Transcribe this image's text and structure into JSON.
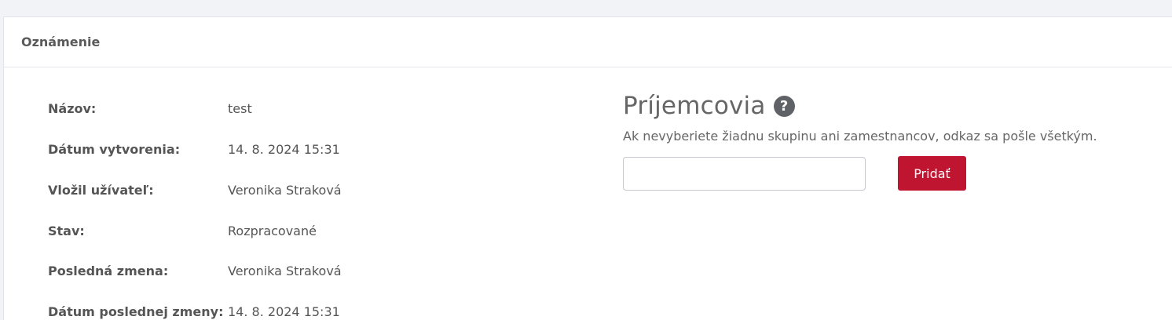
{
  "card": {
    "title": "Oznámenie"
  },
  "details": [
    {
      "label": "Názov:",
      "value": "test"
    },
    {
      "label": "Dátum vytvorenia:",
      "value": "14. 8. 2024 15:31"
    },
    {
      "label": "Vložil užívateľ:",
      "value": "Veronika Straková"
    },
    {
      "label": "Stav:",
      "value": "Rozpracované"
    },
    {
      "label": "Posledná zmena:",
      "value": "Veronika Straková"
    },
    {
      "label": "Dátum poslednej zmeny:",
      "value": "14. 8. 2024 15:31"
    }
  ],
  "recipients": {
    "title": "Príjemcovia",
    "help_icon_glyph": "?",
    "hint": "Ak nevyberiete žiadnu skupinu ani zamestnancov, odkaz sa pošle všetkým.",
    "input_value": "",
    "add_label": "Pridať"
  },
  "colors": {
    "accent": "#c01530",
    "help_icon": "#5f6368"
  }
}
